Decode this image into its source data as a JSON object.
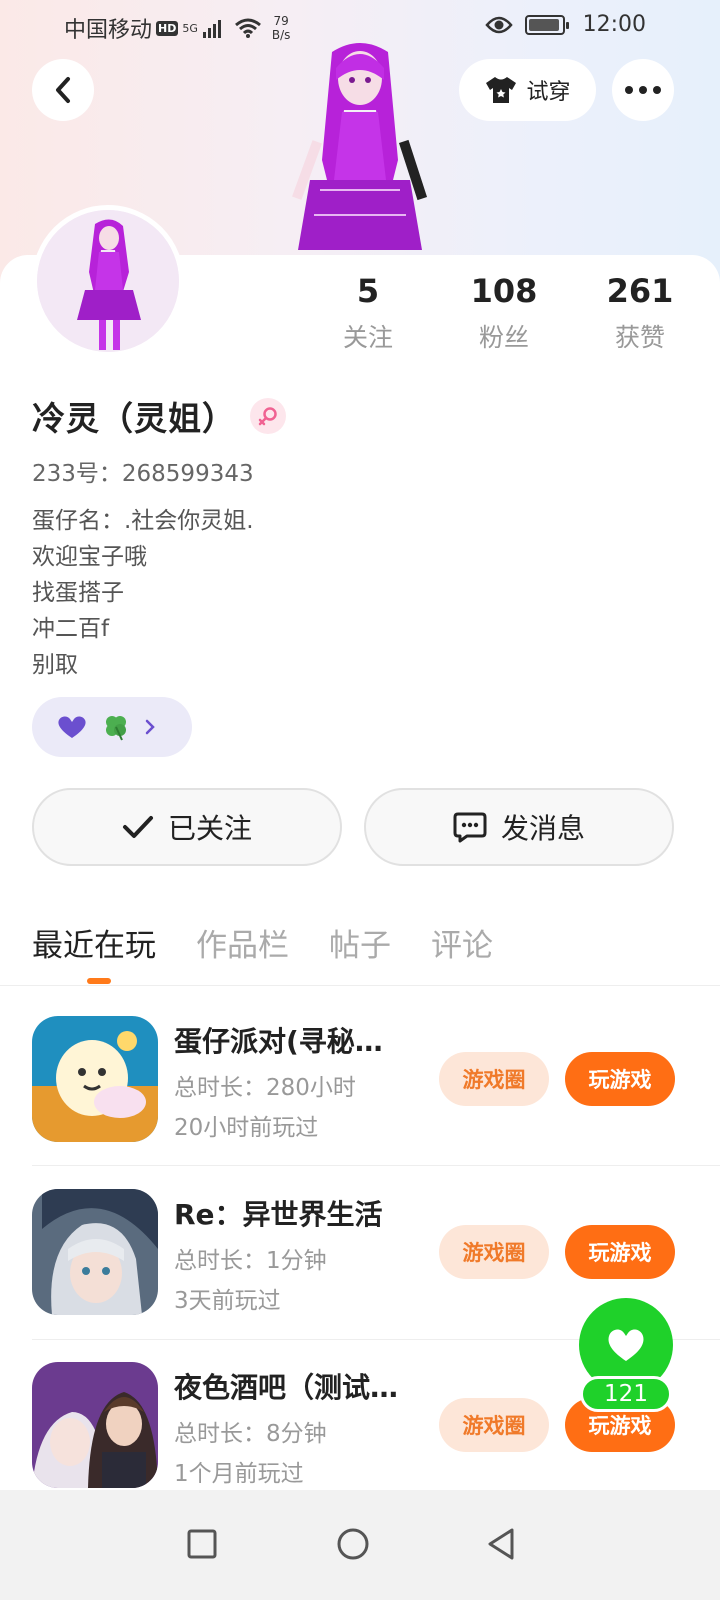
{
  "status_bar": {
    "carrier": "中国移动",
    "hd": "HD",
    "network": "5G",
    "speed_value": "79",
    "speed_unit": "B/s",
    "time": "12:00"
  },
  "header": {
    "try_on_label": "试穿"
  },
  "stats": [
    {
      "value": "5",
      "label": "关注"
    },
    {
      "value": "108",
      "label": "粉丝"
    },
    {
      "value": "261",
      "label": "获赞"
    }
  ],
  "profile": {
    "name": "冷灵（灵姐）",
    "uid": "233号：268599343",
    "bio": [
      "蛋仔名：.社会你灵姐.",
      "欢迎宝子哦",
      "找蛋搭子",
      "冲二百f",
      "别取"
    ]
  },
  "actions": {
    "followed_label": "已关注",
    "message_label": "发消息"
  },
  "tabs": [
    "最近在玩",
    "作品栏",
    "帖子",
    "评论"
  ],
  "games": [
    {
      "title": "蛋仔派对(寻秘…",
      "duration": "总时长：280小时",
      "last_played": "20小时前玩过"
    },
    {
      "title": "Re：异世界生活",
      "duration": "总时长：1分钟",
      "last_played": "3天前玩过"
    },
    {
      "title": "夜色酒吧（测试…",
      "duration": "总时长：8分钟",
      "last_played": "1个月前玩过"
    }
  ],
  "game_buttons": {
    "circle_label": "游戏圈",
    "play_label": "玩游戏"
  },
  "like": {
    "count": "121"
  },
  "colors": {
    "accent_orange": "#ff6e14",
    "like_green": "#1fd12a",
    "game_circle_bg": "#fde6d8"
  }
}
